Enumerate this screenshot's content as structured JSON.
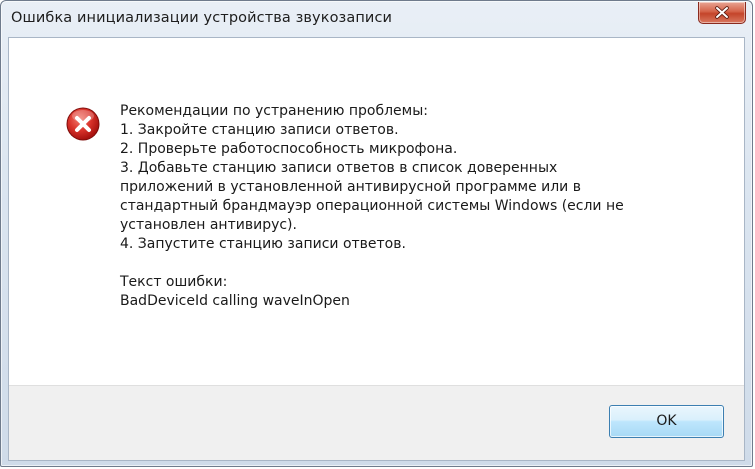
{
  "dialog": {
    "title": "Ошибка инициализации устройства звукозаписи",
    "close_icon": "close-icon",
    "error_icon": "error-icon",
    "message_lines": [
      "Рекомендации по устранению проблемы:",
      "1. Закройте станцию записи ответов.",
      "2. Проверьте работоспособность микрофона.",
      "3. Добавьте станцию записи ответов в список доверенных",
      "приложений в установленной антивирусной программе или в",
      "стандартный брандмауэр операционной системы Windows (если не",
      "установлен антивирус).",
      "4. Запустите станцию записи ответов."
    ],
    "error_label": "Текст ошибки:",
    "error_text": "BadDeviceId calling waveInOpen",
    "ok_label": "OK"
  },
  "colors": {
    "error_red": "#d32a2a",
    "close_button_red": "#c4442a",
    "ok_border_blue": "#3c7fb1"
  }
}
